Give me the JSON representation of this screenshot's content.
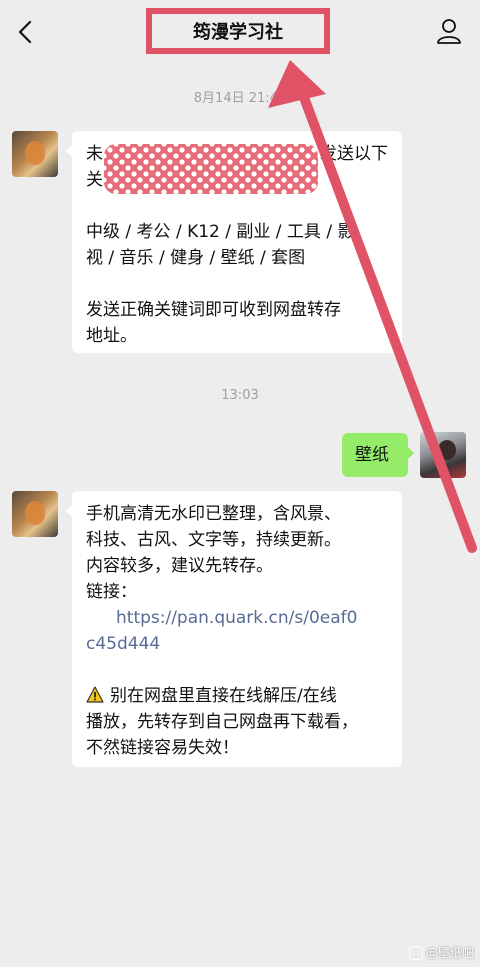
{
  "header": {
    "title": "筠漫学习社",
    "back_icon": "chevron-left-icon",
    "profile_icon": "person-icon"
  },
  "chat": {
    "timestamp_1": "8月14日 21:47",
    "timestamp_2": "13:03",
    "msg1": {
      "line1_left": "未",
      "line1_right": "发送以下",
      "line2_left": "关",
      "para2_line1": "中级 / 考公 / K12 / 副业 / 工具 / 影",
      "para2_line2": "视 / 音乐 / 健身 / 壁纸 / 套图",
      "para3_line1": "发送正确关键词即可收到网盘转存",
      "para3_line2": "地址。"
    },
    "user_msg": "壁纸",
    "msg2": {
      "line1": "手机高清无水印已整理，含风景、",
      "line2": "科技、古风、文字等，持续更新。",
      "line3": "内容较多，建议先转存。",
      "line4": "链接：",
      "link_line1": "https://pan.quark.cn/s/0eaf0",
      "link_line2": "c45d444",
      "warn_line1": "别在网盘里直接在线解压/在线",
      "warn_line2": "播放，先转存到自己网盘再下载看，",
      "warn_line3": "不然链接容易失效！"
    }
  },
  "watermark": "@壁纸吧",
  "colors": {
    "background": "#ededed",
    "bubble_white": "#ffffff",
    "bubble_green": "#95ec69",
    "link": "#576b95",
    "annotation_red": "#e05366",
    "timestamp": "#a0a0a0"
  }
}
